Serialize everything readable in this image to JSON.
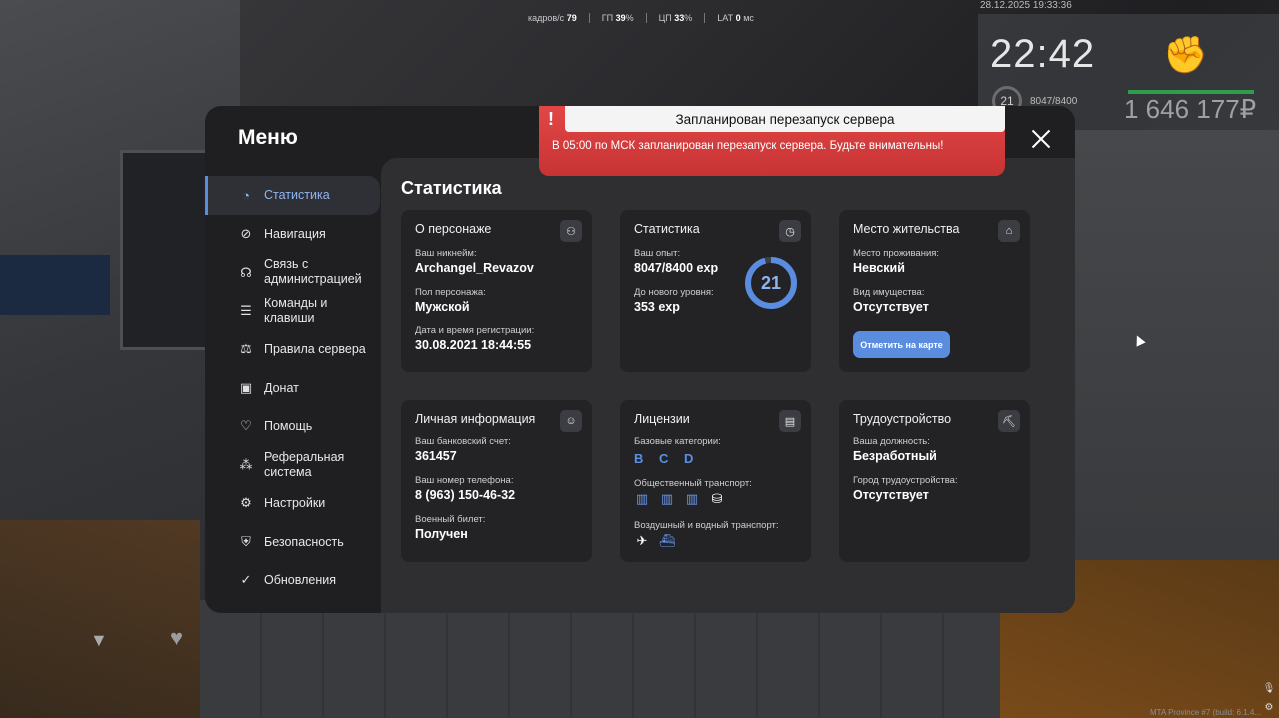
{
  "hud": {
    "fps_label": "кадров/с",
    "fps_value": "79",
    "gpu_label": "ГП",
    "gpu_value": "39",
    "cpu_label": "ЦП",
    "cpu_value": "33",
    "lat_label": "LAT",
    "lat_value": "0",
    "pct": "%",
    "ms": "мс",
    "datetime": "28.12.2025 19:33:36",
    "clock": "22:42",
    "level": "21",
    "exp": "8047/8400",
    "money": "1 646 177₽",
    "build": "MTA Province #7 (build: 6.1.4..."
  },
  "menu": {
    "title": "Меню",
    "nav": [
      {
        "label": "Статистика",
        "icon": "pie-chart-icon"
      },
      {
        "label": "Навигация",
        "icon": "compass-icon"
      },
      {
        "label": "Связь с администрацией",
        "icon": "headset-icon"
      },
      {
        "label": "Команды и клавиши",
        "icon": "document-icon"
      },
      {
        "label": "Правила сервера",
        "icon": "scales-icon"
      },
      {
        "label": "Донат",
        "icon": "wallet-icon"
      },
      {
        "label": "Помощь",
        "icon": "heart-hand-icon"
      },
      {
        "label": "Реферальная система",
        "icon": "network-icon"
      },
      {
        "label": "Настройки",
        "icon": "gear-icon"
      },
      {
        "label": "Безопасность",
        "icon": "shield-icon"
      },
      {
        "label": "Обновления",
        "icon": "refresh-check-icon"
      }
    ]
  },
  "content": {
    "title": "Статистика",
    "character": {
      "title": "О персонаже",
      "nick_label": "Ваш никнейм:",
      "nick": "Archangel_Revazov",
      "sex_label": "Пол персонажа:",
      "sex": "Мужской",
      "reg_label": "Дата и время регистрации:",
      "reg": "30.08.2021 18:44:55"
    },
    "stats": {
      "title": "Статистика",
      "exp_label": "Ваш опыт:",
      "exp": "8047/8400 exp",
      "next_label": "До нового уровня:",
      "next": "353 exp",
      "level": "21",
      "progress": 0.958
    },
    "residence": {
      "title": "Место жительства",
      "place_label": "Место проживания:",
      "place": "Невский",
      "property_label": "Вид имущества:",
      "property": "Отсутствует",
      "button": "Отметить на карте"
    },
    "personal": {
      "title": "Личная информация",
      "bank_label": "Ваш банковский счет:",
      "bank": "361457",
      "phone_label": "Ваш номер телефона:",
      "phone": "8 (963) 150-46-32",
      "military_label": "Военный билет:",
      "military": "Получен"
    },
    "licenses": {
      "title": "Лицензии",
      "basic_label": "Базовые категории:",
      "basic": "B C D",
      "public_label": "Общественный транспорт:",
      "air_label": "Воздушный и водный транспорт:"
    },
    "employment": {
      "title": "Трудоустройство",
      "position_label": "Ваша должность:",
      "position": "Безработный",
      "city_label": "Город трудоустройства:",
      "city": "Отсутствует"
    }
  },
  "notification": {
    "title": "Запланирован перезапуск сервера",
    "text": "В 05:00 по МСК запланирован перезапуск сервера. Будьте внимательны!"
  },
  "colors": {
    "accent": "#5a8ce0",
    "alert": "#d83c3c",
    "health": "#2e9d4c"
  }
}
